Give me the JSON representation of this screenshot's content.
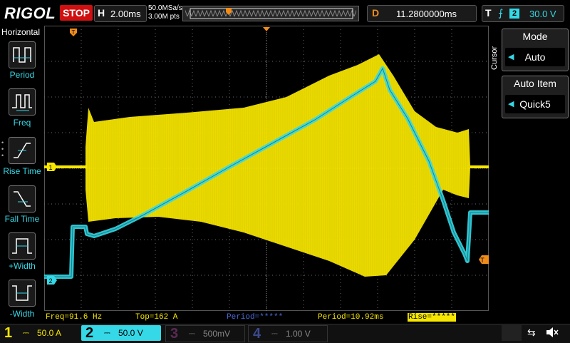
{
  "header": {
    "logo": "RIGOL",
    "run_state": "STOP",
    "timebase_key": "H",
    "timebase": "2.00ms",
    "sample_rate": "50.0MSa/s",
    "mem_depth": "3.00M pts",
    "delay_key": "D",
    "delay": "11.2800000ms",
    "trigger_key": "T",
    "trigger_source": "2",
    "trigger_level": "30.0 V"
  },
  "left_menu": {
    "title": "Horizontal",
    "items": [
      {
        "label": "Period"
      },
      {
        "label": "Freq"
      },
      {
        "label": "Rise Time"
      },
      {
        "label": "Fall Time"
      },
      {
        "label": "+Width"
      },
      {
        "label": "-Width"
      }
    ]
  },
  "right_menu": {
    "tab": "Cursor",
    "mode": {
      "title": "Mode",
      "value": "Auto"
    },
    "auto_item": {
      "title": "Auto Item",
      "value": "Quick5"
    }
  },
  "measurements": {
    "freq": "Freq=91.6 Hz",
    "top": "Top=162 A",
    "period_a": "Period=*****",
    "period_b": "Period=10.92ms",
    "rise": "Rise=*****"
  },
  "channels": [
    {
      "num": "1",
      "coupling": "⎓",
      "scale": "50.0 A",
      "color": "#f7e600",
      "active": true
    },
    {
      "num": "2",
      "coupling": "⎓",
      "scale": "50.0 V",
      "color": "#35d8e6",
      "active": true
    },
    {
      "num": "3",
      "coupling": "⎓",
      "scale": "500mV",
      "color": "#b23fa5",
      "active": false
    },
    {
      "num": "4",
      "coupling": "⎓",
      "scale": "1.00 V",
      "color": "#4a6ad8",
      "active": false
    }
  ],
  "markers": {
    "ch1": "1",
    "ch2": "2",
    "trig": "T"
  },
  "colors": {
    "ch1": "#f7e600",
    "ch2": "#35d8e6",
    "trigger": "#f08c1a",
    "grid": "#6a6a6a"
  }
}
